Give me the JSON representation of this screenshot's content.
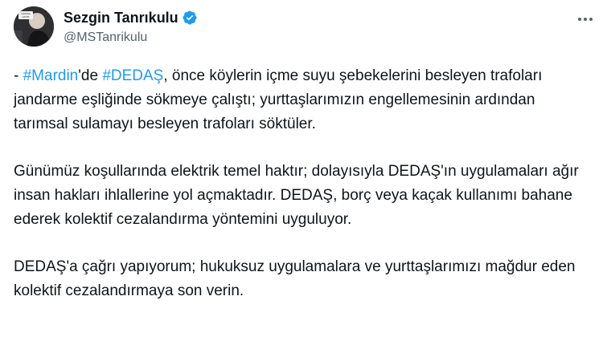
{
  "user": {
    "display_name": "Sezgin Tanrıkulu",
    "handle": "@MSTanrikulu",
    "verified_icon": "verified-badge-icon",
    "avatar_icon": "profile-photo-icon",
    "avatar_text": "SAVAŞA HAYIR"
  },
  "menu": {
    "more_icon": "more-options-icon"
  },
  "tweet": {
    "p1": {
      "prefix": "- ",
      "hashtag1": "#Mardin",
      "mid1": "'de ",
      "hashtag2": "#DEDAŞ",
      "rest": ", önce köylerin içme suyu şebekelerini besleyen trafoları jandarme eşliğinde sökmeye çalıştı; yurttaşlarımızın engellemesinin ardından tarımsal sulamayı besleyen trafoları söktüler."
    },
    "p2": "Günümüz koşullarında elektrik temel haktır; dolayısıyla DEDAŞ'ın uygulamaları ağır insan hakları ihlallerine yol açmaktadır. DEDAŞ, borç veya kaçak kullanımı bahane ederek kolektif cezalandırma yöntemini uyguluyor.",
    "p3": "DEDAŞ'a çağrı yapıyorum; hukuksuz uygulamalara ve yurttaşlarımızı mağdur eden kolektif cezalandırmaya son verin."
  },
  "colors": {
    "hashtag": "#1d9bf0",
    "verified": "#1d9bf0",
    "secondary_text": "#536471",
    "primary_text": "#0f1419"
  }
}
